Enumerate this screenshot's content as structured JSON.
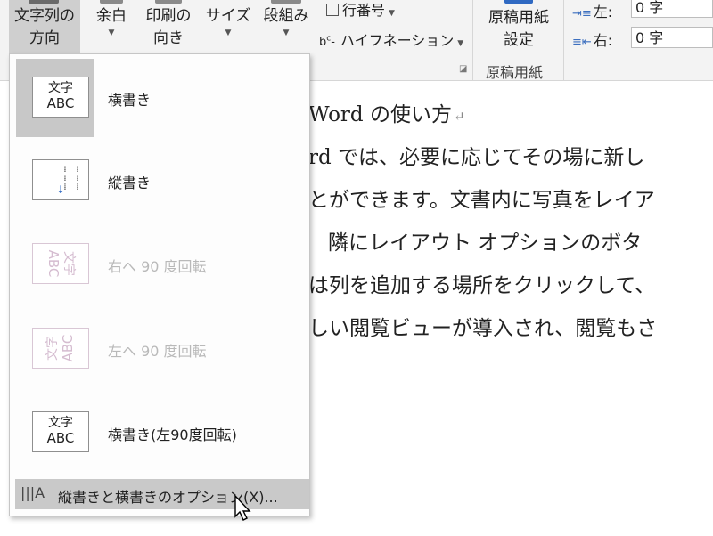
{
  "ribbon": {
    "text_direction_label": "文字列の\n方向",
    "margins_label": "余白",
    "orientation_label": "印刷の\n向き",
    "size_label": "サイズ",
    "columns_label": "段組み",
    "line_numbers_label": "行番号",
    "hyphenation_label": "ハイフネーション",
    "manuscript_settings_label": "原稿用紙\n設定",
    "manuscript_group_label": "原稿用紙",
    "indent_left_label": "左:",
    "indent_right_label": "右:",
    "indent_left_value": "0 字",
    "indent_right_value": "0 字"
  },
  "document": {
    "lines": [
      "Word の使い方",
      "rd では、必要に応じてその場に新し",
      "とができます。文書内に写真をレイア",
      "隣にレイアウト オプションのボタ",
      "は列を追加する場所をクリックして、",
      "しい閲覧ビューが導入され、閲覧もさ"
    ]
  },
  "menu": {
    "items": [
      {
        "label": "横書き",
        "thumb_top": "文字",
        "thumb_bottom": "ABC",
        "selected": true,
        "disabled": false
      },
      {
        "label": "縦書き",
        "selected": false,
        "disabled": false
      },
      {
        "label": "右へ 90 度回転",
        "thumb_top": "文字",
        "thumb_bottom": "ABC",
        "selected": false,
        "disabled": true
      },
      {
        "label": "左へ 90 度回転",
        "thumb_top": "文字",
        "thumb_bottom": "ABC",
        "selected": false,
        "disabled": true
      },
      {
        "label": "横書き(左90度回転)",
        "thumb_top": "文字",
        "thumb_bottom": "ABC",
        "selected": false,
        "disabled": false
      }
    ],
    "footer_label": "縦書きと横書きのオプション(X)..."
  }
}
